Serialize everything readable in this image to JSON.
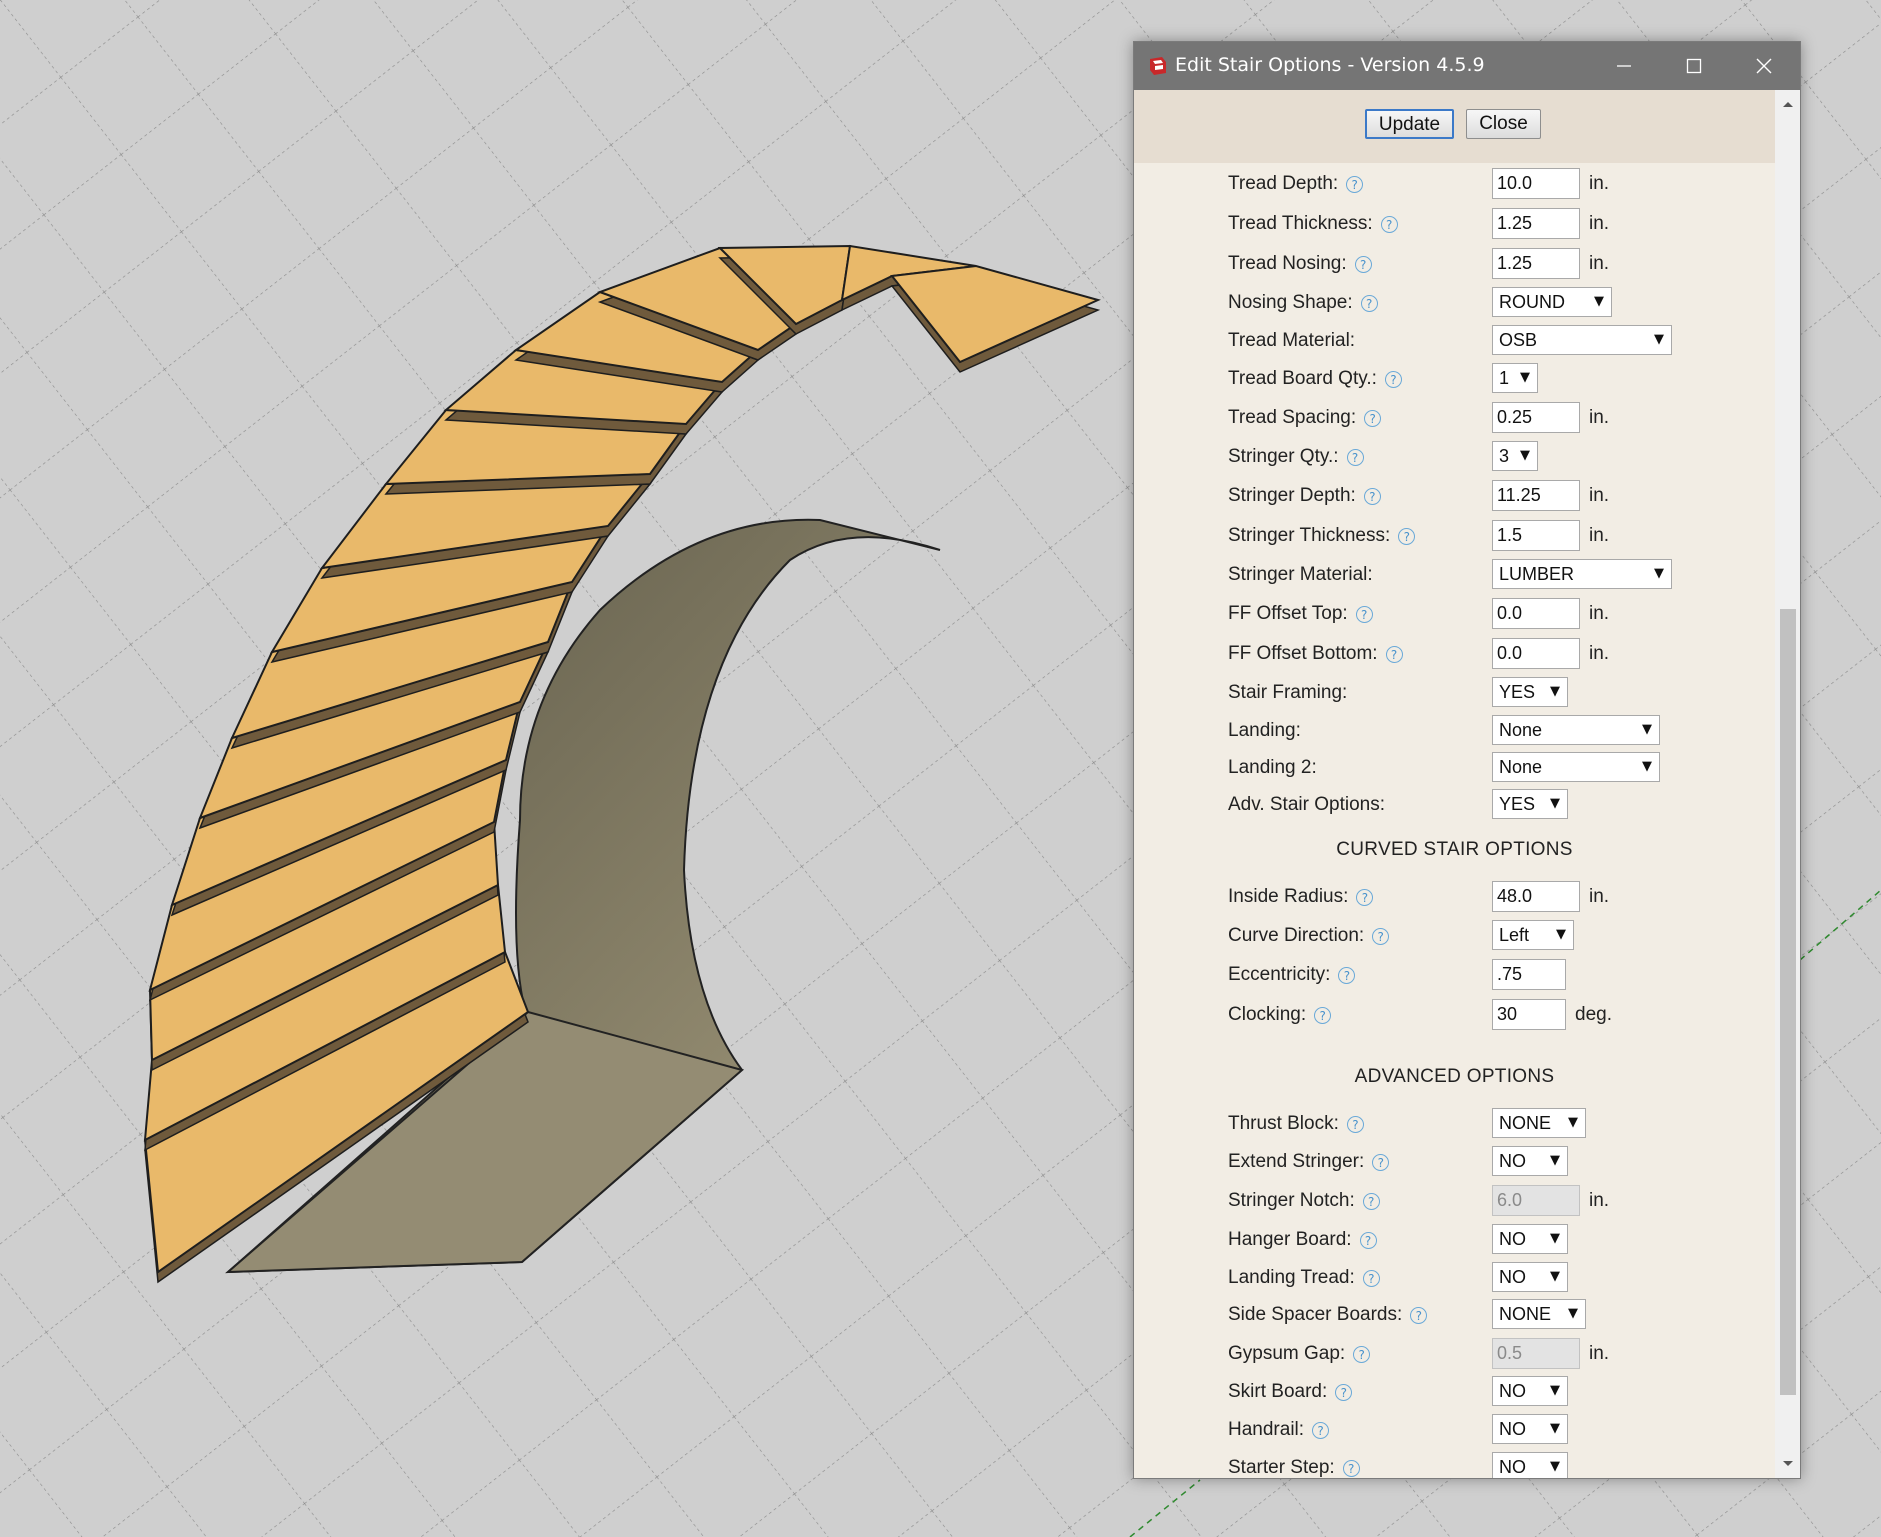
{
  "dialog": {
    "title": "Edit Stair Options - Version 4.5.9",
    "update_label": "Update",
    "close_label": "Close"
  },
  "fields": [
    {
      "label": "Tread Depth:",
      "help": true,
      "type": "input",
      "value": "10.0",
      "unit": "in."
    },
    {
      "label": "Tread Thickness:",
      "help": true,
      "type": "input",
      "value": "1.25",
      "unit": "in."
    },
    {
      "label": "Tread Nosing:",
      "help": true,
      "type": "input",
      "value": "1.25",
      "unit": "in."
    },
    {
      "label": "Nosing Shape:",
      "help": true,
      "type": "select",
      "value": "ROUND"
    },
    {
      "label": "Tread Material:",
      "help": false,
      "type": "select",
      "value": "OSB"
    },
    {
      "label": "Tread Board Qty.:",
      "help": true,
      "type": "select",
      "value": "1"
    },
    {
      "label": "Tread Spacing:",
      "help": true,
      "type": "input",
      "value": "0.25",
      "unit": "in."
    },
    {
      "label": "Stringer Qty.:",
      "help": true,
      "type": "select",
      "value": "3"
    },
    {
      "label": "Stringer Depth:",
      "help": true,
      "type": "input",
      "value": "11.25",
      "unit": "in."
    },
    {
      "label": "Stringer Thickness:",
      "help": true,
      "type": "input",
      "value": "1.5",
      "unit": "in."
    },
    {
      "label": "Stringer Material:",
      "help": false,
      "type": "select",
      "value": "LUMBER"
    },
    {
      "label": "FF Offset Top:",
      "help": true,
      "type": "input",
      "value": "0.0",
      "unit": "in."
    },
    {
      "label": "FF Offset Bottom:",
      "help": true,
      "type": "input",
      "value": "0.0",
      "unit": "in."
    },
    {
      "label": "Stair Framing:",
      "help": false,
      "type": "select",
      "value": "YES"
    },
    {
      "label": "Landing:",
      "help": false,
      "type": "select",
      "value": "None"
    },
    {
      "label": "Landing 2:",
      "help": false,
      "type": "select",
      "value": "None"
    },
    {
      "label": "Adv. Stair Options:",
      "help": false,
      "type": "select",
      "value": "YES"
    }
  ],
  "curved_section": {
    "title": "CURVED STAIR OPTIONS",
    "fields": [
      {
        "label": "Inside Radius:",
        "help": true,
        "type": "input",
        "value": "48.0",
        "unit": "in."
      },
      {
        "label": "Curve Direction:",
        "help": true,
        "type": "select",
        "value": "Left"
      },
      {
        "label": "Eccentricity:",
        "help": true,
        "type": "input",
        "value": ".75"
      },
      {
        "label": "Clocking:",
        "help": true,
        "type": "input",
        "value": "30",
        "unit": "deg."
      }
    ]
  },
  "advanced_section": {
    "title": "ADVANCED OPTIONS",
    "fields": [
      {
        "label": "Thrust Block:",
        "help": true,
        "type": "select",
        "value": "NONE"
      },
      {
        "label": "Extend Stringer:",
        "help": true,
        "type": "select",
        "value": "NO"
      },
      {
        "label": "Stringer Notch:",
        "help": true,
        "type": "input",
        "value": "6.0",
        "unit": "in.",
        "disabled": true
      },
      {
        "label": "Hanger Board:",
        "help": true,
        "type": "select",
        "value": "NO"
      },
      {
        "label": "Landing Tread:",
        "help": true,
        "type": "select",
        "value": "NO"
      },
      {
        "label": "Side Spacer Boards:",
        "help": true,
        "type": "select",
        "value": "NONE"
      },
      {
        "label": "Gypsum Gap:",
        "help": true,
        "type": "input",
        "value": "0.5",
        "unit": "in.",
        "disabled": true
      },
      {
        "label": "Skirt Board:",
        "help": true,
        "type": "select",
        "value": "NO"
      },
      {
        "label": "Handrail:",
        "help": true,
        "type": "select",
        "value": "NO"
      },
      {
        "label": "Starter Step:",
        "help": true,
        "type": "select",
        "value": "NO"
      }
    ]
  },
  "icons": {
    "app": "sketchup-icon",
    "help": "help-icon",
    "minimize": "minimize-icon",
    "maximize": "maximize-icon",
    "close": "close-icon",
    "dropdown": "chevron-down-icon"
  },
  "colors": {
    "titlebar": "#757575",
    "panel": "#f2ede4",
    "toolbar": "#e6ddd1",
    "tread": "#e9b96a",
    "stringer": "#8d8468",
    "ground": "#cfcfcf",
    "accent": "#3b79c8"
  }
}
